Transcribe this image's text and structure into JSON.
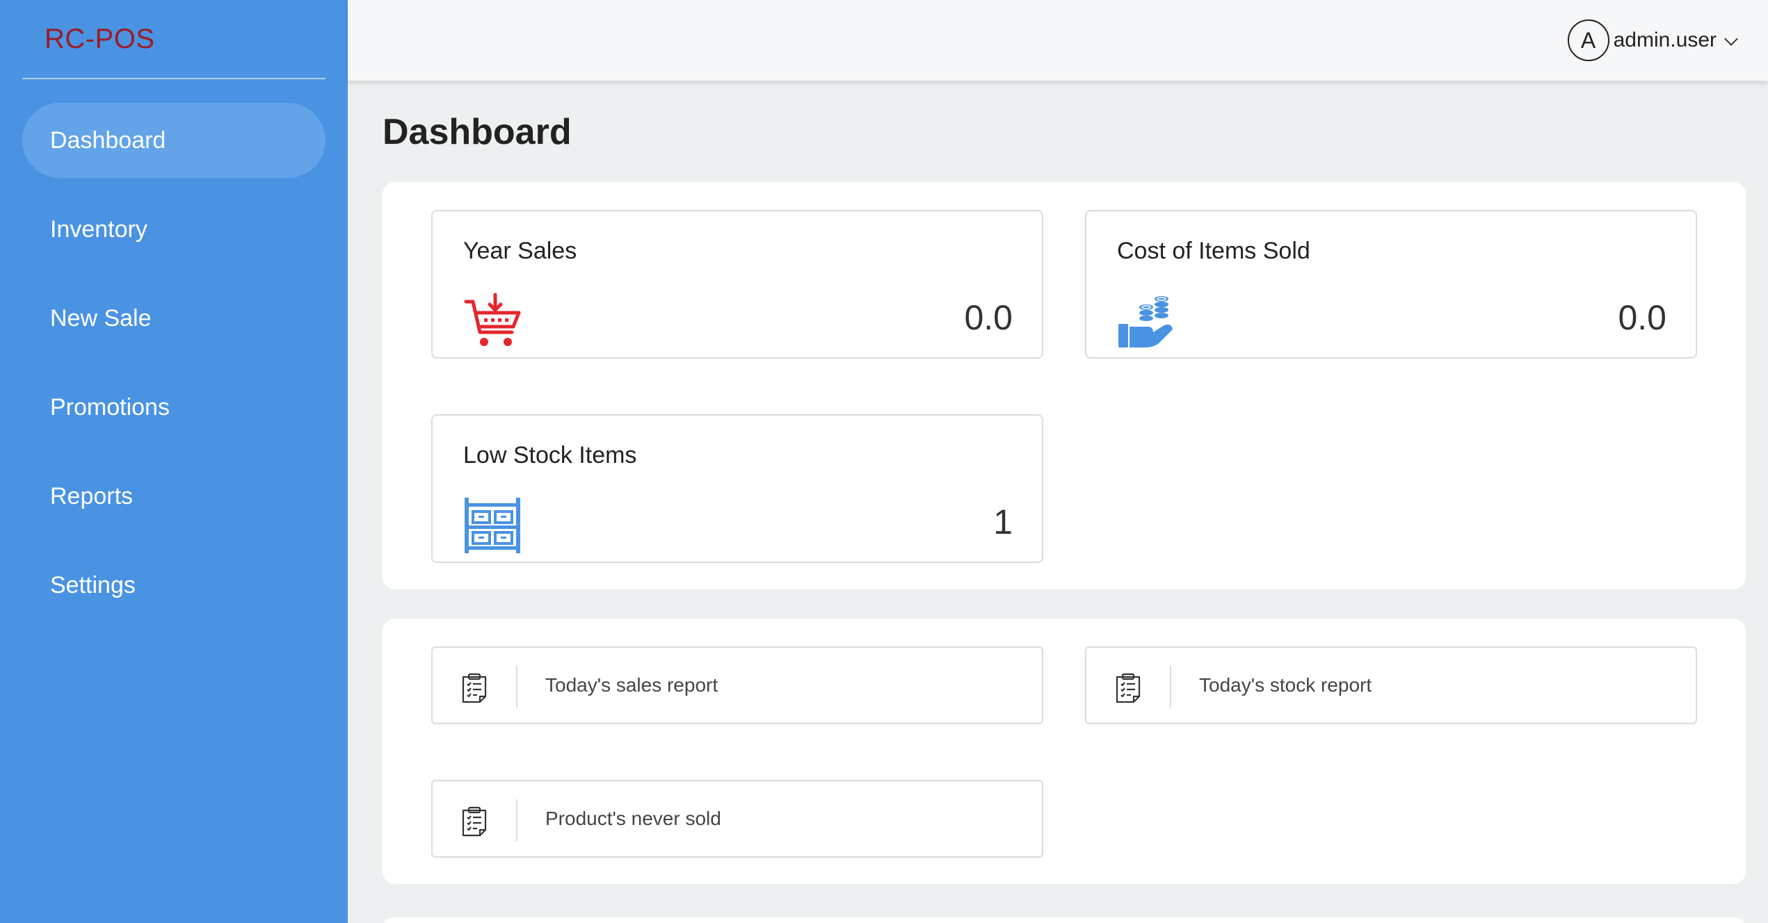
{
  "brand": {
    "name": "RC-POS",
    "color": "#9b1d24"
  },
  "colors": {
    "sidebar": "#4a93e3",
    "sidebar_active": "#63a4e9",
    "cart_icon": "#e6262d",
    "blue_icon": "#4a93e3"
  },
  "sidebar": {
    "items": [
      {
        "label": "Dashboard",
        "active": true
      },
      {
        "label": "Inventory",
        "active": false
      },
      {
        "label": "New Sale",
        "active": false
      },
      {
        "label": "Promotions",
        "active": false
      },
      {
        "label": "Reports",
        "active": false
      },
      {
        "label": "Settings",
        "active": false
      }
    ]
  },
  "header": {
    "avatar_letter": "A",
    "username": "admin.user",
    "dropdown_icon": "chevron-down-icon"
  },
  "main": {
    "title": "Dashboard",
    "stats": [
      {
        "title": "Year Sales",
        "value": "0.0",
        "icon": "cart-download-icon"
      },
      {
        "title": "Cost of Items Sold",
        "value": "0.0",
        "icon": "hand-coins-icon"
      },
      {
        "title": "Low Stock Items",
        "value": "1",
        "icon": "warehouse-shelf-icon"
      }
    ],
    "reports": [
      {
        "label": "Today's sales report",
        "icon": "clipboard-icon"
      },
      {
        "label": "Today's stock report",
        "icon": "clipboard-icon"
      },
      {
        "label": "Product's never sold",
        "icon": "clipboard-icon"
      }
    ]
  }
}
